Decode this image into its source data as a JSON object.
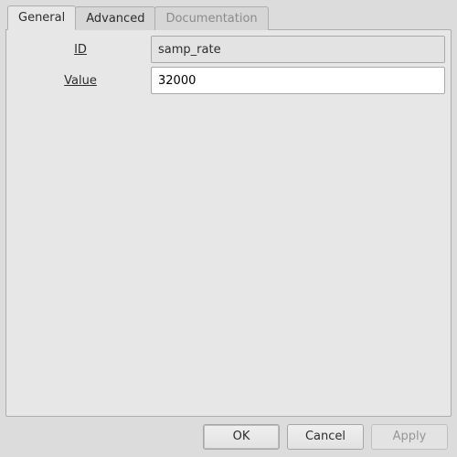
{
  "tabs": {
    "general": "General",
    "advanced": "Advanced",
    "documentation": "Documentation"
  },
  "form": {
    "id_label": "ID",
    "id_value": "samp_rate",
    "value_label": "Value",
    "value_value": "32000"
  },
  "buttons": {
    "ok": "OK",
    "cancel": "Cancel",
    "apply": "Apply"
  }
}
